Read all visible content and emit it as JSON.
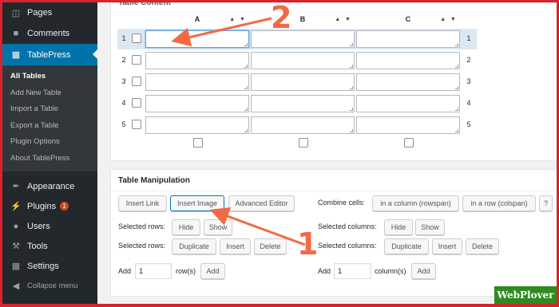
{
  "sidebar": {
    "top_items": [
      {
        "label": "Pages",
        "icon": "pages-icon"
      },
      {
        "label": "Comments",
        "icon": "comments-icon"
      }
    ],
    "current": {
      "label": "TablePress",
      "icon": "tablepress-icon"
    },
    "submenu": [
      "All Tables",
      "Add New Table",
      "Import a Table",
      "Export a Table",
      "Plugin Options",
      "About TablePress"
    ],
    "bottom_items": [
      {
        "label": "Appearance",
        "icon": "appearance-icon"
      },
      {
        "label": "Plugins",
        "icon": "plugins-icon",
        "badge": "1"
      },
      {
        "label": "Users",
        "icon": "users-icon"
      },
      {
        "label": "Tools",
        "icon": "tools-icon"
      },
      {
        "label": "Settings",
        "icon": "settings-icon"
      }
    ],
    "collapse": "Collapse menu"
  },
  "content": {
    "title": "Table Content",
    "columns": [
      "A",
      "B",
      "C"
    ],
    "sort_glyphs": "▲ ▼",
    "rows": [
      "1",
      "2",
      "3",
      "4",
      "5"
    ]
  },
  "manipulation": {
    "title": "Table Manipulation",
    "insert_link": "Insert Link",
    "insert_image": "Insert Image",
    "advanced_editor": "Advanced Editor",
    "combine_label": "Combine cells:",
    "rowspan": "in a column (rowspan)",
    "colspan": "in a row (colspan)",
    "help": "?",
    "sel_rows": "Selected rows:",
    "sel_cols": "Selected columns:",
    "hide": "Hide",
    "show": "Show",
    "duplicate": "Duplicate",
    "insert": "Insert",
    "delete": "Delete",
    "add": "Add",
    "add_rows_value": "1",
    "add_cols_value": "1",
    "rows_suffix": "row(s)",
    "cols_suffix": "column(s)"
  },
  "annotations": {
    "num1": "1",
    "num2": "2",
    "arrow_color": "#f26a45"
  },
  "watermark": "WebPlover",
  "colors": {
    "sidebar": "#23282d",
    "accent": "#0073aa",
    "frame": "#d9232e"
  }
}
